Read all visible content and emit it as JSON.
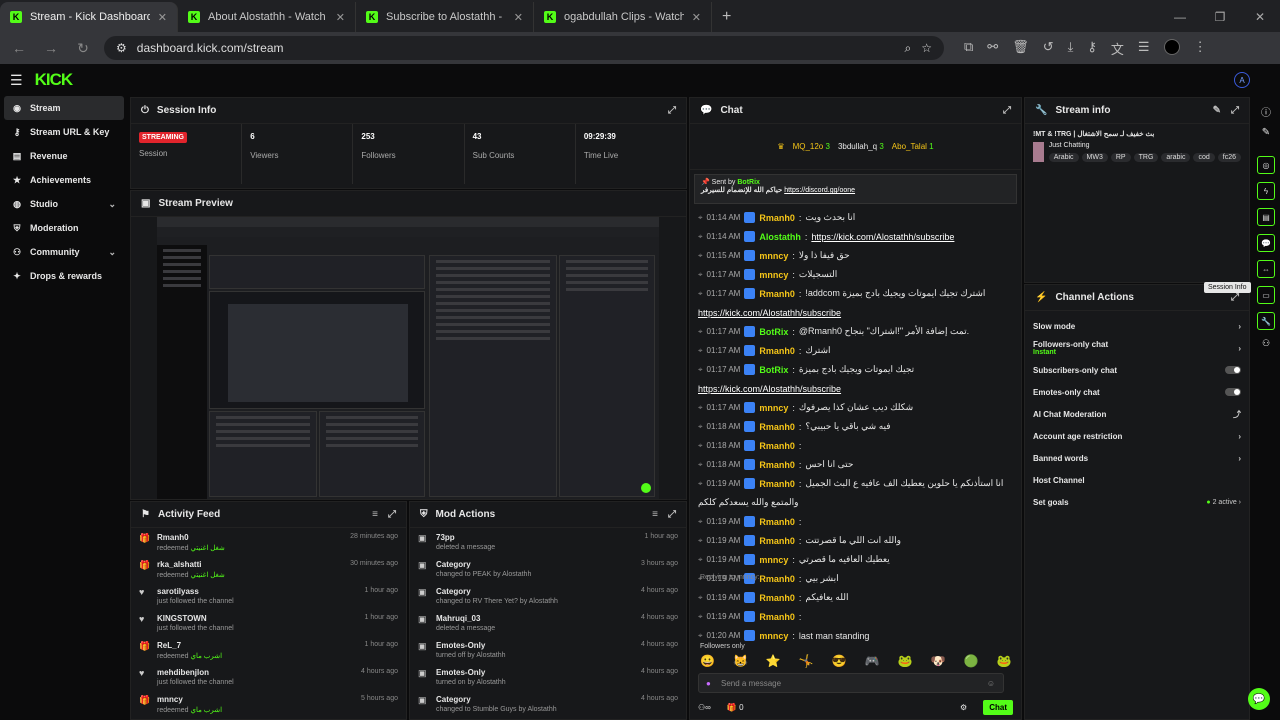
{
  "browser": {
    "tabs": [
      {
        "title": "Stream - Kick Dashboard",
        "active": true
      },
      {
        "title": "About Alostathh - Watch Live o",
        "active": false
      },
      {
        "title": "Subscribe to Alostathh - Kick St",
        "active": false
      },
      {
        "title": "ogabdullah Clips - Watch Live o",
        "active": false
      }
    ],
    "url": "dashboard.kick.com/stream"
  },
  "kick": {
    "logo": "KICK"
  },
  "sidebar": {
    "items": [
      {
        "label": "Stream",
        "icon": "broadcast-icon",
        "active": true
      },
      {
        "label": "Stream URL & Key",
        "icon": "key-icon"
      },
      {
        "label": "Revenue",
        "icon": "revenue-icon"
      },
      {
        "label": "Achievements",
        "icon": "trophy-icon"
      },
      {
        "label": "Studio",
        "icon": "studio-icon",
        "chevron": true
      },
      {
        "label": "Moderation",
        "icon": "shield-icon"
      },
      {
        "label": "Community",
        "icon": "community-icon",
        "chevron": true
      },
      {
        "label": "Drops & rewards",
        "icon": "gift-icon"
      }
    ]
  },
  "session_info": {
    "title": "Session Info",
    "stats": [
      {
        "value": "STREAMING",
        "label": "Session"
      },
      {
        "value": "6",
        "label": "Viewers"
      },
      {
        "value": "253",
        "label": "Followers"
      },
      {
        "value": "43",
        "label": "Sub Counts"
      },
      {
        "value": "09:29:39",
        "label": "Time Live"
      }
    ]
  },
  "stream_preview": {
    "title": "Stream Preview"
  },
  "activity_feed": {
    "title": "Activity Feed",
    "items": [
      {
        "name": "Rmanh0",
        "action": "redeemed",
        "reward": "شغل اغنيتي",
        "time": "28 minutes ago",
        "icon": "gift-icon"
      },
      {
        "name": "rka_alshatti",
        "action": "redeemed",
        "reward": "شغل اغنيتي",
        "time": "30 minutes ago",
        "icon": "gift-icon"
      },
      {
        "name": "sarotilyass",
        "action": "just followed the channel",
        "reward": "",
        "time": "1 hour ago",
        "icon": "heart-icon"
      },
      {
        "name": "KINGSTOWN",
        "action": "just followed the channel",
        "reward": "",
        "time": "1 hour ago",
        "icon": "heart-icon"
      },
      {
        "name": "ReL_7",
        "action": "redeemed",
        "reward": "اشرب ماي",
        "time": "1 hour ago",
        "icon": "gift-icon"
      },
      {
        "name": "mehdibenjlon",
        "action": "just followed the channel",
        "reward": "",
        "time": "4 hours ago",
        "icon": "heart-icon"
      },
      {
        "name": "mnncy",
        "action": "redeemed",
        "reward": "اشرب ماي",
        "time": "5 hours ago",
        "icon": "gift-icon"
      }
    ]
  },
  "mod_actions": {
    "title": "Mod Actions",
    "items": [
      {
        "name": "73pp",
        "desc": "deleted a message",
        "time": "1 hour ago"
      },
      {
        "name": "Category",
        "desc": "changed to PEAK by Alostathh",
        "time": "3 hours ago"
      },
      {
        "name": "Category",
        "desc": "changed to RV There Yet? by Alostathh",
        "time": "4 hours ago"
      },
      {
        "name": "Mahruqi_03",
        "desc": "deleted a message",
        "time": "4 hours ago"
      },
      {
        "name": "Emotes-Only",
        "desc": "turned off by Alostathh",
        "time": "4 hours ago"
      },
      {
        "name": "Emotes-Only",
        "desc": "turned on by Alostathh",
        "time": "4 hours ago"
      },
      {
        "name": "Category",
        "desc": "changed to Stumble Guys by Alostathh",
        "time": "4 hours ago"
      }
    ]
  },
  "chat": {
    "title": "Chat",
    "gifters": [
      {
        "name": "MQ_12o",
        "count": "3"
      },
      {
        "name": "3bdullah_q",
        "count": "3"
      },
      {
        "name": "Abo_Talal",
        "count": "1"
      }
    ],
    "pinned": {
      "sent_by": "Sent by",
      "bot": "BotRix",
      "text": "حياكم الله للإنضمام للسيرفر",
      "link": "https://discord.gg/oone"
    },
    "messages": [
      {
        "time": "01:14 AM",
        "user": "Rmanh0",
        "color": "#f5c518",
        "text": "انا بحدث ويت"
      },
      {
        "time": "01:14 AM",
        "user": "Alostathh",
        "color": "#53fc18",
        "text": "",
        "link": "https://kick.com/Alostathh/subscribe"
      },
      {
        "time": "01:15 AM",
        "user": "mnncy",
        "color": "#f5c518",
        "text": "حق فيفا ذا ولا"
      },
      {
        "time": "01:17 AM",
        "user": "mnncy",
        "color": "#f5c518",
        "text": "التسجيلات"
      },
      {
        "time": "01:17 AM",
        "user": "Rmanh0",
        "color": "#f5c518",
        "text": "!addcom اشترك تجيك ايموتات ويجيك بادج بميزة"
      },
      {
        "time": "",
        "user": "",
        "color": "#fff",
        "text": "",
        "link": "https://kick.com/Alostathh/subscribe"
      },
      {
        "time": "01:17 AM",
        "user": "BotRix",
        "color": "#53fc18",
        "text": "@Rmanh0 تمت إضافة الأمر \"!اشتراك\" بنجاح."
      },
      {
        "time": "01:17 AM",
        "user": "Rmanh0",
        "color": "#f5c518",
        "text": "اشترك"
      },
      {
        "time": "01:17 AM",
        "user": "BotRix",
        "color": "#53fc18",
        "text": "تجيك ايموتات ويجيك بادج بميزة"
      },
      {
        "time": "",
        "user": "",
        "color": "#fff",
        "text": "",
        "link": "https://kick.com/Alostathh/subscribe"
      },
      {
        "time": "01:17 AM",
        "user": "mnncy",
        "color": "#f5c518",
        "text": "شكلك ديب عشان كذا يصرفوك"
      },
      {
        "time": "01:18 AM",
        "user": "Rmanh0",
        "color": "#f5c518",
        "text": "فيه شي باقي يا حبيبي؟"
      },
      {
        "time": "01:18 AM",
        "user": "Rmanh0",
        "color": "#f5c518",
        "text": ""
      },
      {
        "time": "01:18 AM",
        "user": "Rmanh0",
        "color": "#f5c518",
        "text": "حتى انا احس"
      },
      {
        "time": "01:19 AM",
        "user": "Rmanh0",
        "color": "#f5c518",
        "text": "انا استأذنكم يا حلوين يعطيك الف عافيه ع البث الجميل"
      },
      {
        "time": "",
        "user": "",
        "color": "#fff",
        "text": "والمتمع والله يسعدكم كلكم"
      },
      {
        "time": "01:19 AM",
        "user": "Rmanh0",
        "color": "#f5c518",
        "text": ""
      },
      {
        "time": "01:19 AM",
        "user": "Rmanh0",
        "color": "#f5c518",
        "text": "والله انت اللي ما قصرتتت"
      },
      {
        "time": "01:19 AM",
        "user": "mnncy",
        "color": "#f5c518",
        "text": "يعطيك العافيه ما قصرتي"
      },
      {
        "time": "01:19 AM",
        "user": "Rmanh0",
        "color": "#f5c518",
        "text": "ابشر بيي"
      },
      {
        "time": "01:19 AM",
        "user": "Rmanh0",
        "color": "#f5c518",
        "text": "الله يعافيكم"
      },
      {
        "time": "01:19 AM",
        "user": "Rmanh0",
        "color": "#f5c518",
        "text": ""
      },
      {
        "time": "01:20 AM",
        "user": "mnncy",
        "color": "#f5c518",
        "text": "last man standing"
      }
    ],
    "replying": "Replying to mnncy:",
    "followers_only": "Followers only",
    "input_placeholder": "Send a message",
    "footer_count": "0",
    "send_label": "Chat"
  },
  "stream_info": {
    "title": "Stream info",
    "stream_title": "!MT & !TRG | بث خفيف لـ سمح الاشتغال",
    "category": "Just Chatting",
    "tags": [
      "Arabic",
      "MW3",
      "RP",
      "TRG",
      "arabic",
      "cod",
      "fc26"
    ]
  },
  "channel_actions": {
    "title": "Channel Actions",
    "items": [
      {
        "label": "Slow mode",
        "sub": "",
        "control": "chevron"
      },
      {
        "label": "Followers-only chat",
        "sub": "Instant",
        "control": "chevron"
      },
      {
        "label": "Subscribers-only chat",
        "sub": "",
        "control": "toggle"
      },
      {
        "label": "Emotes-only chat",
        "sub": "",
        "control": "toggle"
      },
      {
        "label": "AI Chat Moderation",
        "sub": "",
        "control": "external"
      },
      {
        "label": "Account age restriction",
        "sub": "",
        "control": "chevron"
      },
      {
        "label": "Banned words",
        "sub": "",
        "control": "chevron"
      },
      {
        "label": "Host Channel",
        "sub": "",
        "control": "none"
      },
      {
        "label": "Set goals",
        "sub": "",
        "control": "active",
        "badge": "2 active"
      }
    ]
  },
  "rail": {
    "tooltip": "Session Info"
  },
  "colors": {
    "accent": "#53fc18",
    "streaming": "#e1242c",
    "panel": "#17181a"
  }
}
